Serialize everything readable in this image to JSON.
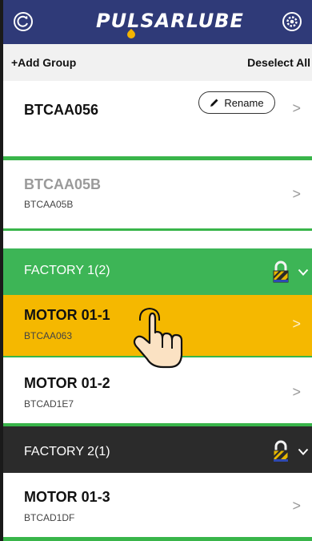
{
  "header": {
    "logo_text": "PULSARLUBE",
    "brand_color": "#2f3a78",
    "left_icon": "refresh-icon",
    "right_icon": "gear-icon"
  },
  "toolbar": {
    "add_group_label": "+Add Group",
    "deselect_all_label": "Deselect All"
  },
  "devices_top": [
    {
      "title": "BTCAA056",
      "subtitle": "",
      "rename_label": "Rename"
    },
    {
      "title": "BTCAA05B",
      "subtitle": "BTCAA05B"
    }
  ],
  "groups": [
    {
      "label": "FACTORY 1(2)",
      "color": "#3db556",
      "lock_icon": "lock-icon",
      "items": [
        {
          "title": "MOTOR 01-1",
          "subtitle": "BTCAA063",
          "selected": true,
          "selected_color": "#f5b800"
        },
        {
          "title": "MOTOR 01-2",
          "subtitle": "BTCAD1E7"
        }
      ]
    },
    {
      "label": "FACTORY 2(1)",
      "color": "#2b2b2b",
      "lock_icon": "lock-icon",
      "items": [
        {
          "title": "MOTOR 01-3",
          "subtitle": "BTCAD1DF"
        }
      ]
    }
  ],
  "chevron": ">"
}
